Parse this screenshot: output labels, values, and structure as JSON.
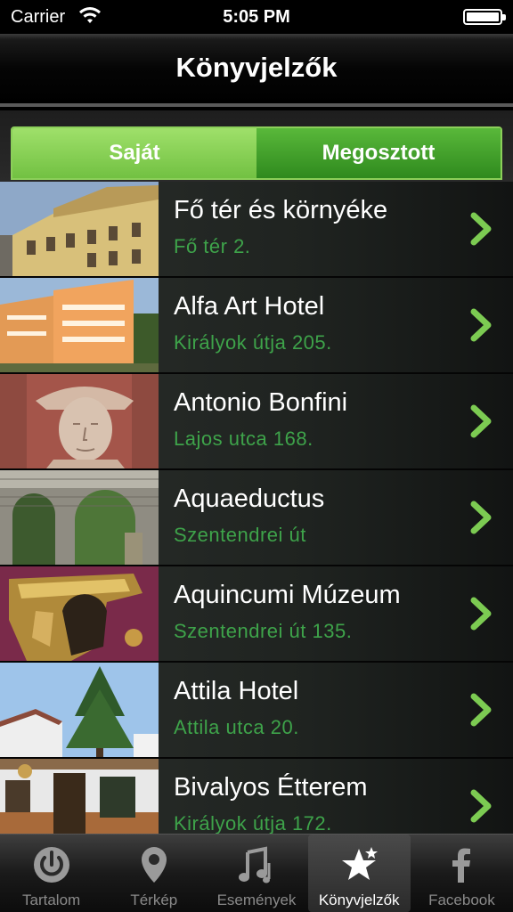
{
  "status_bar": {
    "carrier": "Carrier",
    "time": "5:05 PM"
  },
  "nav": {
    "title": "Könyvjelzők"
  },
  "segments": [
    {
      "label": "Saját",
      "active": true
    },
    {
      "label": "Megosztott",
      "active": false
    }
  ],
  "bookmarks": [
    {
      "name": "Fő tér és környéke",
      "address": "Fő tér 2.",
      "image": "yellow-baroque-building-photo"
    },
    {
      "name": "Alfa Art Hotel",
      "address": "Királyok útja 205.",
      "image": "orange-hotel-building-photo"
    },
    {
      "name": "Antonio Bonfini",
      "address": "Lajos utca 168.",
      "image": "stone-relief-portrait-photo"
    },
    {
      "name": "Aquaeductus",
      "address": "Szentendrei út",
      "image": "roman-aqueduct-arches-photo"
    },
    {
      "name": "Aquincumi Múzeum",
      "address": "Szentendrei út 135.",
      "image": "golden-helmet-artifact-photo"
    },
    {
      "name": "Attila Hotel",
      "address": "Attila utca 20.",
      "image": "pine-tree-and-house-photo"
    },
    {
      "name": "Bivalyos Étterem",
      "address": "Királyok útja 172.",
      "image": "restaurant-facade-photo"
    }
  ],
  "tabs": [
    {
      "label": "Tartalom",
      "icon": "power-icon",
      "active": false
    },
    {
      "label": "Térkép",
      "icon": "map-pin-icon",
      "active": false
    },
    {
      "label": "Események",
      "icon": "music-notes-icon",
      "active": false
    },
    {
      "label": "Könyvjelzők",
      "icon": "stars-icon",
      "active": true
    },
    {
      "label": "Facebook",
      "icon": "facebook-icon",
      "active": false
    }
  ],
  "colors": {
    "accent_green": "#3ea34a",
    "segment_active": "#8ad35a",
    "segment_inactive": "#45a52c"
  }
}
